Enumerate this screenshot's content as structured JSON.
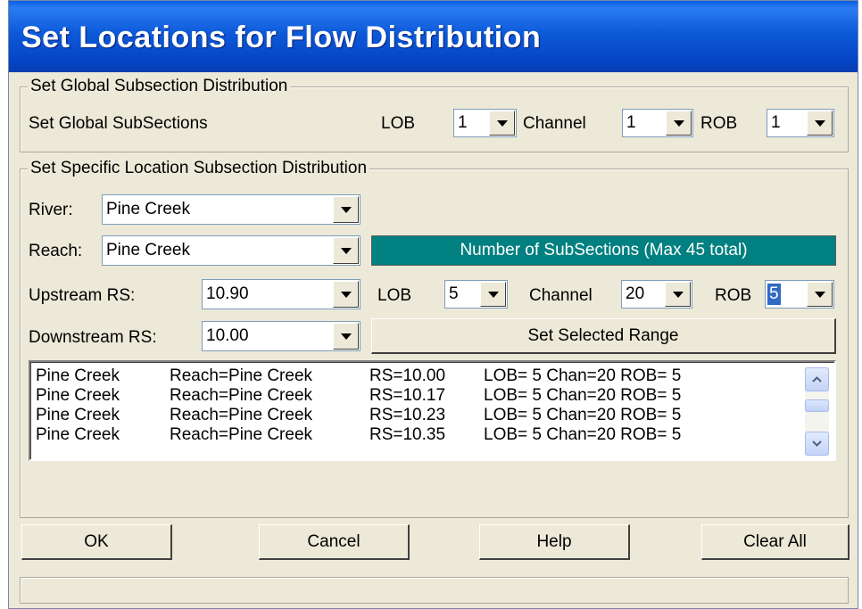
{
  "window": {
    "title": "Set Locations for Flow Distribution"
  },
  "global": {
    "legend": "Set Global Subsection Distribution",
    "row_label": "Set Global SubSections",
    "lob_label": "LOB",
    "lob_value": "1",
    "channel_label": "Channel",
    "channel_value": "1",
    "rob_label": "ROB",
    "rob_value": "1"
  },
  "specific": {
    "legend": "Set Specific Location Subsection Distribution",
    "river_label": "River:",
    "river_value": "Pine Creek",
    "reach_label": "Reach:",
    "reach_value": "Pine Creek",
    "banner": "Number of SubSections (Max 45 total)",
    "upstream_label": "Upstream RS:",
    "upstream_value": "10.90",
    "downstream_label": "Downstream RS:",
    "downstream_value": "10.00",
    "lob_label": "LOB",
    "lob_value": "5",
    "channel_label": "Channel",
    "channel_value": "20",
    "rob_label": "ROB",
    "rob_value": "5",
    "set_range_button": "Set Selected Range"
  },
  "list": {
    "rows": [
      {
        "river": "Pine Creek",
        "reach": "Reach=Pine Creek",
        "rs": "RS=10.00",
        "sub": "LOB= 5 Chan=20 ROB= 5"
      },
      {
        "river": "Pine Creek",
        "reach": "Reach=Pine Creek",
        "rs": "RS=10.17",
        "sub": "LOB= 5 Chan=20 ROB= 5"
      },
      {
        "river": "Pine Creek",
        "reach": "Reach=Pine Creek",
        "rs": "RS=10.23",
        "sub": "LOB= 5 Chan=20 ROB= 5"
      },
      {
        "river": "Pine Creek",
        "reach": "Reach=Pine Creek",
        "rs": "RS=10.35",
        "sub": "LOB= 5 Chan=20 ROB= 5"
      }
    ]
  },
  "buttons": {
    "ok": "OK",
    "cancel": "Cancel",
    "help": "Help",
    "clear_all": "Clear All"
  },
  "icons": {
    "dropdown": "chevron-down-icon",
    "scroll_up": "chevron-up-icon",
    "scroll_down": "chevron-down-icon"
  },
  "colors": {
    "title_bar": "#0a55d8",
    "banner": "#008080",
    "dialog_bg": "#ece9d8",
    "selection": "#316ac5"
  }
}
